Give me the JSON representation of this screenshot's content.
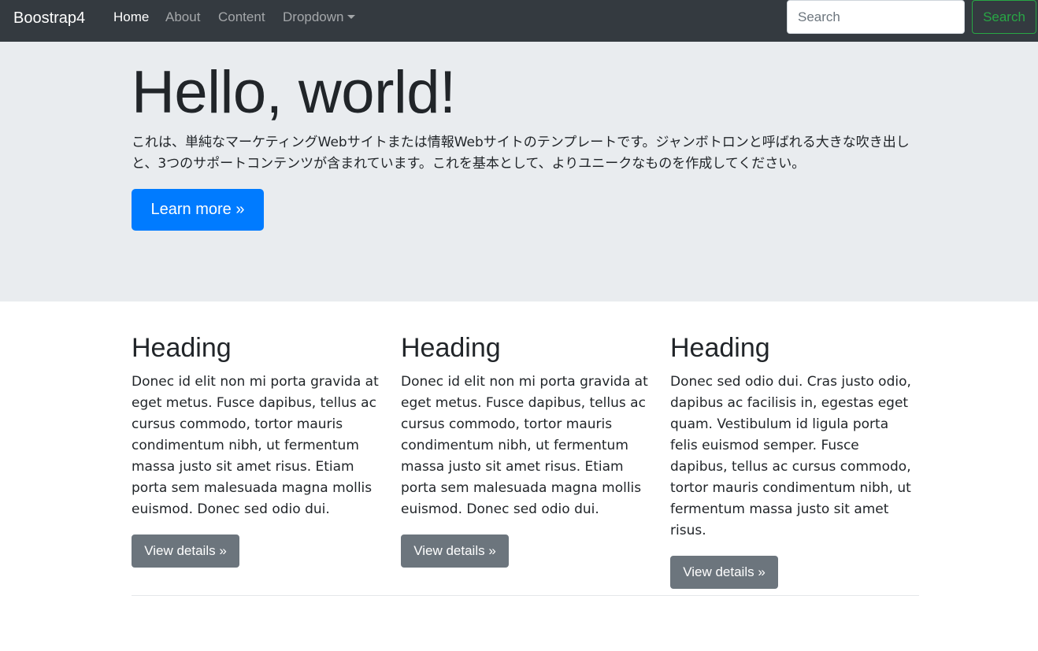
{
  "navbar": {
    "brand": "Boostrap4",
    "links": [
      {
        "label": "Home",
        "active": true
      },
      {
        "label": "About",
        "active": false
      },
      {
        "label": "Content",
        "active": false
      },
      {
        "label": "Dropdown",
        "active": false
      }
    ],
    "search": {
      "placeholder": "Search",
      "value": ""
    },
    "search_button": "Search"
  },
  "jumbotron": {
    "title": "Hello, world!",
    "lead": "これは、単純なマーケティングWebサイトまたは情報Webサイトのテンプレートです。ジャンボトロンと呼ばれる大きな吹き出しと、3つのサポートコンテンツが含まれています。これを基本として、よりユニークなものを作成してください。",
    "button": "Learn more »"
  },
  "columns": [
    {
      "heading": "Heading",
      "text": "Donec id elit non mi porta gravida at eget metus. Fusce dapibus, tellus ac cursus commodo, tortor mauris condimentum nibh, ut fermentum massa justo sit amet risus. Etiam porta sem malesuada magna mollis euismod. Donec sed odio dui.",
      "button": "View details »"
    },
    {
      "heading": "Heading",
      "text": "Donec id elit non mi porta gravida at eget metus. Fusce dapibus, tellus ac cursus commodo, tortor mauris condimentum nibh, ut fermentum massa justo sit amet risus. Etiam porta sem malesuada magna mollis euismod. Donec sed odio dui.",
      "button": "View details »"
    },
    {
      "heading": "Heading",
      "text": "Donec sed odio dui. Cras justo odio, dapibus ac facilisis in, egestas eget quam. Vestibulum id ligula porta felis euismod semper. Fusce dapibus, tellus ac cursus commodo, tortor mauris condimentum nibh, ut fermentum massa justo sit amet risus.",
      "button": "View details »"
    }
  ],
  "colors": {
    "navbar_bg": "#343a40",
    "jumbotron_bg": "#e9ecef",
    "primary": "#007bff",
    "secondary": "#6c757d",
    "success": "#28a745"
  }
}
